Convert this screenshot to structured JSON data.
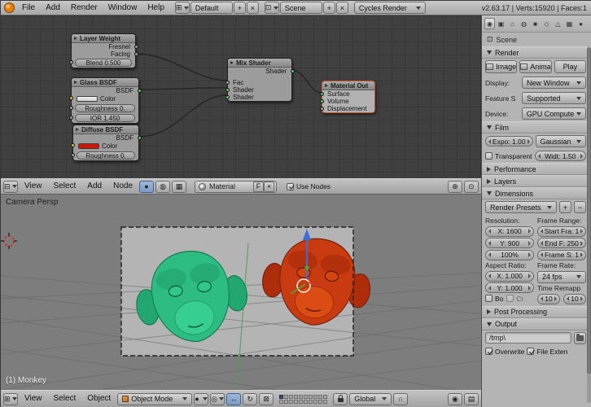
{
  "colors": {
    "accent_orange": "#e87d0d",
    "green_material": "#2dbd83",
    "red_material": "#c83a10",
    "node_editor_bg": "#404040",
    "panel_bg": "#b4b4b4",
    "manipulator_blue": "#3a6fd8"
  },
  "icons": {
    "plus": "+",
    "minus": "−",
    "close": "×",
    "screen": "⊞",
    "scene": "⊡",
    "editor_node": "⊟",
    "editor_view3d": "⊞",
    "node_tree_types": [
      "●",
      "◍",
      "▦"
    ],
    "zoom": "⊕",
    "pin": "⊙",
    "shading": "●",
    "pivot": "◎",
    "translate": "↔",
    "rotate": "↻",
    "scale": "⊠",
    "magnet": "∩",
    "render_cam": "◉",
    "render_seq": "▤"
  },
  "info_bar": {
    "menus": [
      "File",
      "Add",
      "Render",
      "Window",
      "Help"
    ],
    "layout": "Default",
    "scene": "Scene",
    "engine": "Cycles Render",
    "stats": "v2.63.17 | Verts:15920 | Faces:1"
  },
  "node_editor": {
    "nodes": {
      "layer_weight": {
        "title": "Layer Weight",
        "outputs": [
          "Fresnel",
          "Facing"
        ],
        "blend": "Blend 0.500"
      },
      "glass": {
        "title": "Glass BSDF",
        "output": "BSDF",
        "color_label": "Color",
        "roughness": "Roughness 0.",
        "ior": "IOR 1.450"
      },
      "diffuse": {
        "title": "Diffuse BSDF",
        "output": "BSDF",
        "color_label": "Color",
        "roughness": "Roughness 0."
      },
      "mix": {
        "title": "Mix Shader",
        "output": "Shader",
        "inputs": [
          "Fac",
          "Shader",
          "Shader"
        ]
      },
      "material_out": {
        "title": "Material Out",
        "inputs": [
          "Surface",
          "Volume",
          "Displacement"
        ]
      }
    },
    "header": {
      "menus": [
        "View",
        "Select",
        "Add",
        "Node"
      ],
      "material": "Material",
      "fake_user": "F",
      "use_nodes": "Use Nodes"
    }
  },
  "viewport": {
    "view_label": "Camera Persp",
    "active_object": "(1) Monkey",
    "header": {
      "menus": [
        "View",
        "Select",
        "Object"
      ],
      "mode": "Object Mode",
      "orientation": "Global"
    }
  },
  "properties": {
    "tab_icons": [
      "◉",
      "▣",
      "⌂",
      "◍",
      "■",
      "◇",
      "△",
      "▦",
      "●"
    ],
    "context_name": "Scene",
    "render": {
      "title": "Render",
      "buttons": [
        "Image",
        "Anima",
        "Play"
      ],
      "display_label": "Display:",
      "display_value": "New Window",
      "feature_label": "Feature S",
      "feature_value": "Supported",
      "device_label": "Device:",
      "device_value": "GPU Compute"
    },
    "film": {
      "title": "Film",
      "exposure": "Expo: 1.00",
      "filter": "Gaussian",
      "transparent": "Transparent",
      "width": "Widt: 1.50"
    },
    "performance": {
      "title": "Performance"
    },
    "layers": {
      "title": "Layers"
    },
    "dimensions": {
      "title": "Dimensions",
      "presets": "Render Presets",
      "resolution_label": "Resolution:",
      "res_x": "X: 1600",
      "res_y": "Y: 900",
      "percentage": "100%",
      "aspect_label": "Aspect Ratio:",
      "aspect_x": "X: 1.000",
      "aspect_y": "Y: 1.000",
      "border": "Bo",
      "crop": "Cr",
      "frame_range_label": "Frame Range:",
      "frame_start": "Start Fra: 1",
      "frame_end": "End F: 250",
      "frame_step": "Frame S: 1",
      "frame_rate_label": "Frame Rate:",
      "fps": "24 fps",
      "time_remap_label": "Time Remapp",
      "remap_old": "10",
      "remap_new": "10"
    },
    "post": {
      "title": "Post Processing"
    },
    "output": {
      "title": "Output",
      "path": "/tmp\\",
      "overwrite": "Overwrite",
      "file_ext": "File Exten"
    }
  }
}
